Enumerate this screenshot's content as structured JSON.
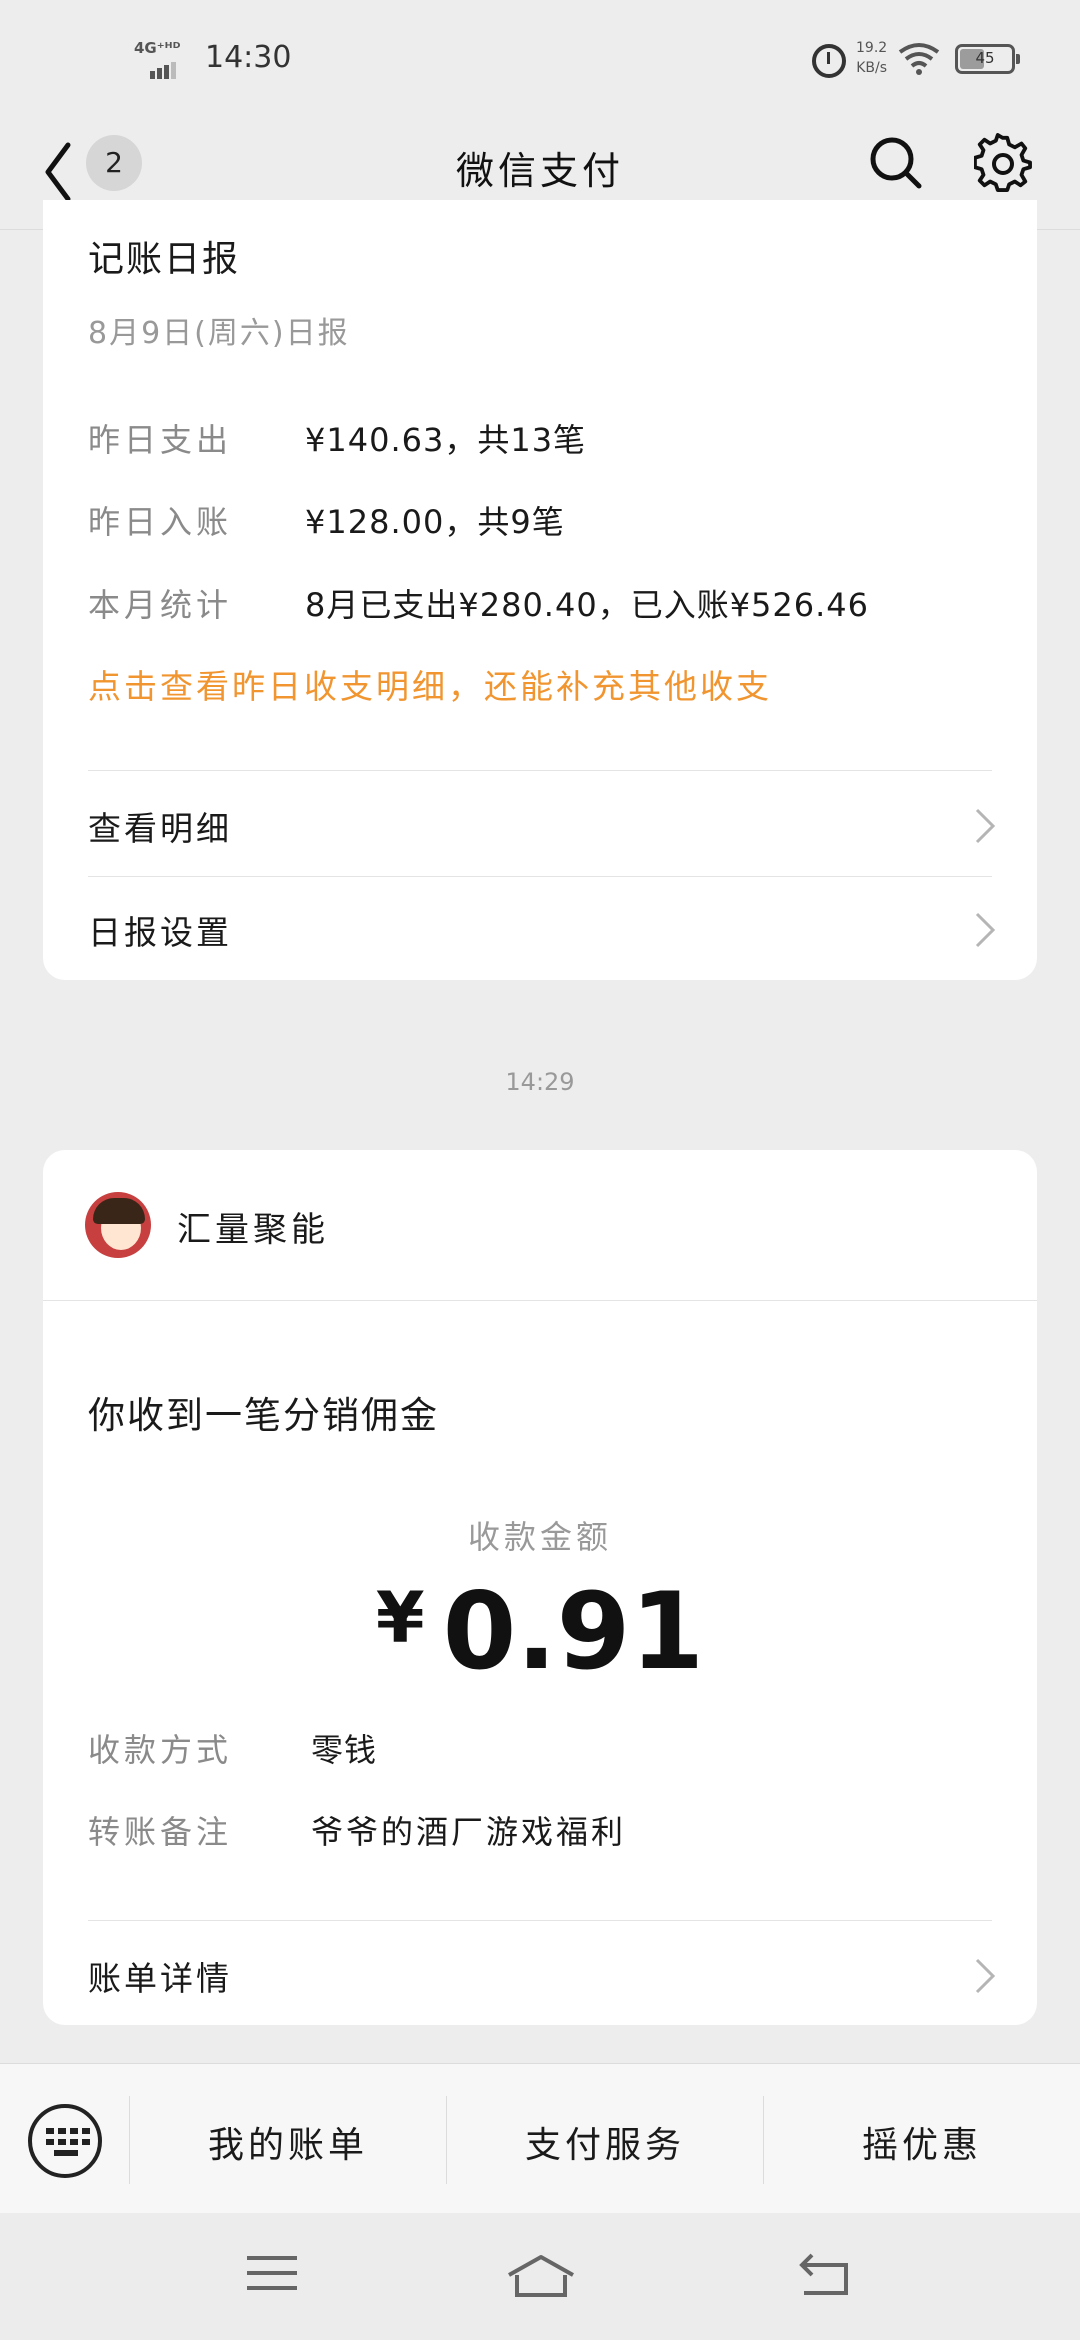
{
  "status_bar": {
    "network": "4G⁺ᴴᴰ",
    "time": "14:30",
    "speed_value": "19.2",
    "speed_unit": "KB/s",
    "battery_level": "45"
  },
  "header": {
    "back_badge": "2",
    "title": "微信支付"
  },
  "daily_report": {
    "title": "记账日报",
    "date": "8月9日(周六)日报",
    "rows": [
      {
        "label": "昨日支出",
        "value": "¥140.63，共13笔"
      },
      {
        "label": "昨日入账",
        "value": "¥128.00，共9笔"
      },
      {
        "label": "本月统计",
        "value": "8月已支出¥280.40，已入账¥526.46"
      }
    ],
    "tip": "点击查看昨日收支明细，还能补充其他收支",
    "links": [
      "查看明细",
      "日报设置"
    ]
  },
  "timestamp": "14:29",
  "payment_card": {
    "merchant": "汇量聚能",
    "message": "你收到一笔分销佣金",
    "amount_label": "收款金额",
    "currency": "¥",
    "amount": "0.91",
    "rows": [
      {
        "label": "收款方式",
        "value": "零钱"
      },
      {
        "label": "转账备注",
        "value": "爷爷的酒厂游戏福利"
      }
    ],
    "link": "账单详情"
  },
  "bottom_menu": {
    "items": [
      "我的账单",
      "支付服务",
      "摇优惠"
    ]
  },
  "colors": {
    "background": "#ededed",
    "card": "#ffffff",
    "tip": "#f0952f"
  }
}
